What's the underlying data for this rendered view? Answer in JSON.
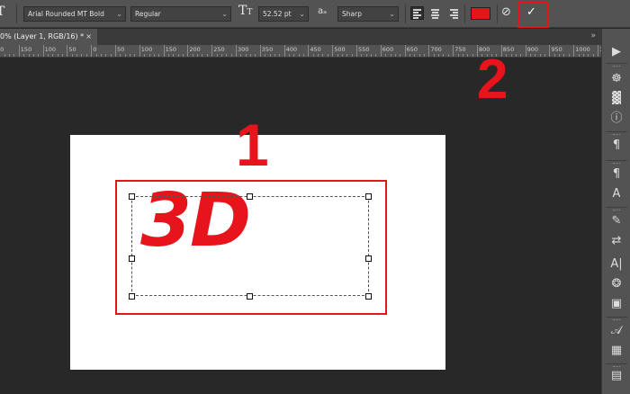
{
  "options_bar": {
    "font_family": "Arial Rounded MT Bold",
    "font_style": "Regular",
    "font_size": "52.52 pt",
    "antialias_label": "aₐ",
    "antialias_value": "Sharp",
    "text_color": "#e8141b",
    "commit_symbol": "✓",
    "cancel_symbol": "⊘"
  },
  "document_tab": {
    "title": "0% (Layer 1, RGB/16) *",
    "close": "×"
  },
  "ruler": {
    "labels": [
      "50",
      "150",
      "100",
      "50",
      "0",
      "50",
      "100",
      "150",
      "200",
      "250",
      "300",
      "350",
      "400",
      "450",
      "500",
      "550",
      "600",
      "650",
      "700",
      "750",
      "800",
      "850",
      "900",
      "950",
      "1000",
      "1050"
    ]
  },
  "canvas": {
    "text_content": "3D",
    "accent_color": "#e8141b"
  },
  "annotations": {
    "step1": "1",
    "step2": "2"
  },
  "right_panel": {
    "icons": [
      "play-icon",
      "sun-icon",
      "histogram-icon",
      "info-icon",
      "paragraph-icon",
      "paragraph-styles-icon",
      "character-styles-icon",
      "brush-icon",
      "adjust-icon",
      "character-icon",
      "stamp-icon",
      "layers-icon",
      "glyphs-icon",
      "layer-comps-icon",
      "notes-icon"
    ],
    "labels": [
      "▶",
      "☸",
      "▓",
      "ⓘ",
      "¶",
      "¶",
      "A",
      "✎",
      "⇄",
      "A|",
      "❂",
      "▣",
      "𝒜",
      "▦",
      "▤"
    ]
  }
}
